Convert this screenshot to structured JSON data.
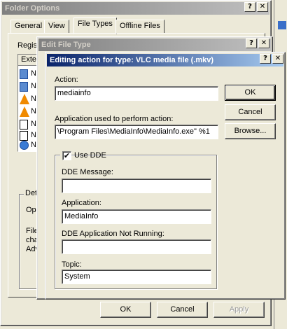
{
  "folder_options": {
    "title": "Folder Options",
    "help_btn": "?",
    "close_btn": "✕",
    "tabs": [
      "General",
      "View",
      "File Types",
      "Offline Files"
    ],
    "registered_label": "Regis",
    "list_header": "Exte",
    "list_items": [
      "N",
      "N",
      "N",
      "N",
      "N",
      "N",
      "N"
    ],
    "details_label": "Deta",
    "opens_label": "Ope",
    "files_text": [
      "Files",
      "cha",
      "Adv"
    ],
    "ok": "OK",
    "cancel": "Cancel",
    "apply": "Apply"
  },
  "edit_file_type": {
    "title": "Edit File Type",
    "help_btn": "?",
    "close_btn": "✕"
  },
  "editing_action": {
    "title": "Editing action for type: VLC media file (.mkv)",
    "help_btn": "?",
    "close_btn": "✕",
    "action_label": "Action:",
    "action_value": "mediainfo",
    "app_label": "Application used to perform action:",
    "app_value": "\\Program Files\\MediaInfo\\MediaInfo.exe\" %1",
    "ok": "OK",
    "cancel": "Cancel",
    "browse": "Browse...",
    "use_dde_label": "Use DDE",
    "use_dde_checked": true,
    "dde_message_label": "DDE Message:",
    "dde_message_value": "",
    "application_label": "Application:",
    "application_value": "MediaInfo",
    "dde_not_running_label": "DDE Application Not Running:",
    "dde_not_running_value": "",
    "topic_label": "Topic:",
    "topic_value": "System"
  }
}
